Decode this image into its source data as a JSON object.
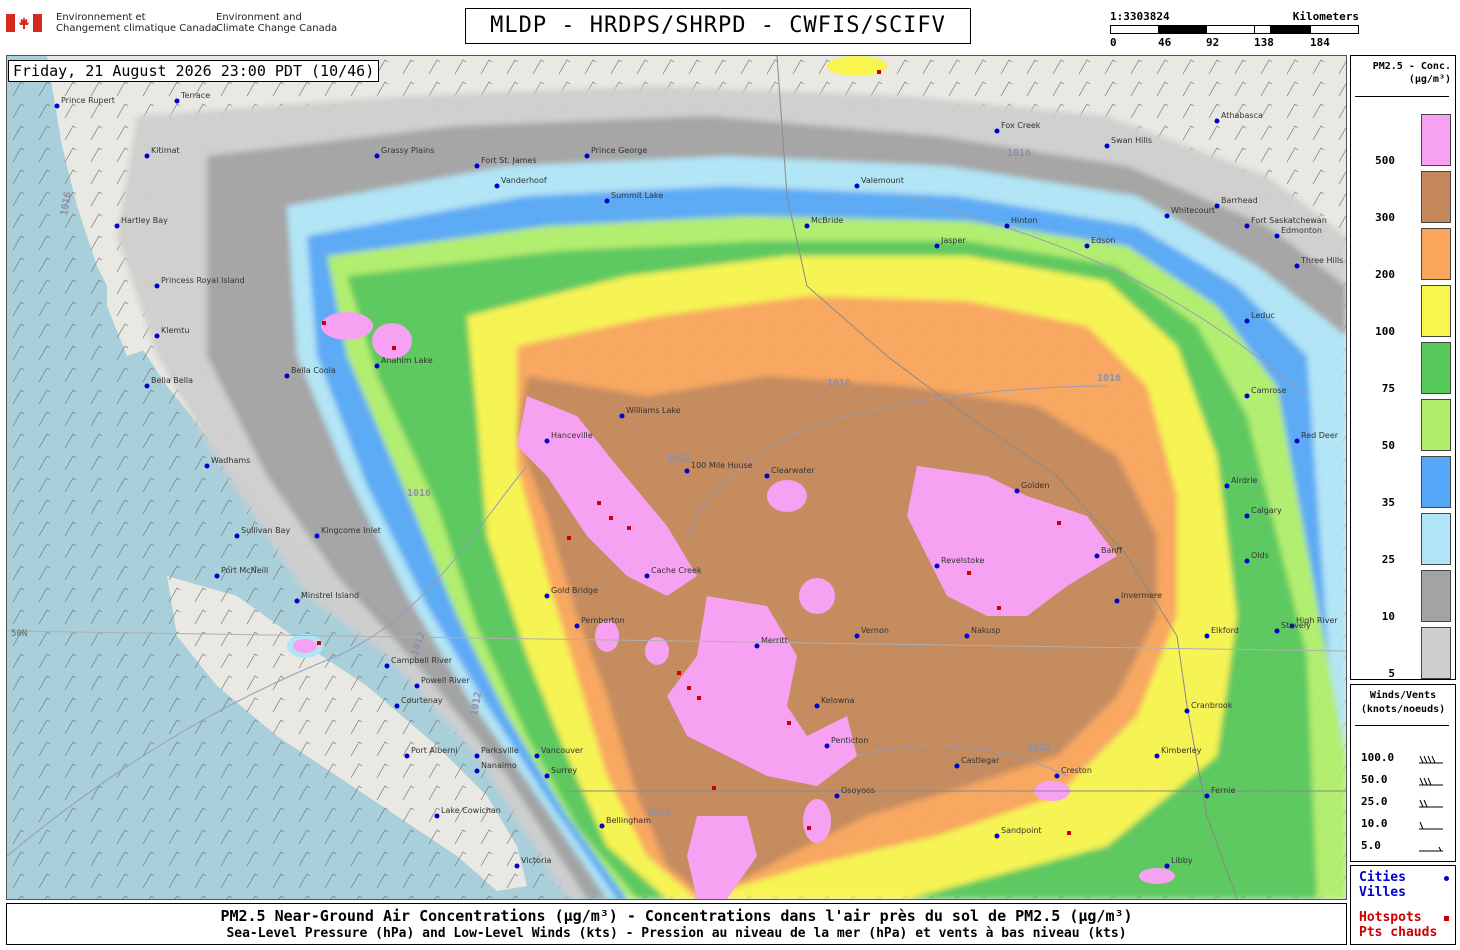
{
  "header": {
    "agency_fr_line1": "Environnement et",
    "agency_fr_line2": "Changement climatique Canada",
    "agency_en_line1": "Environment and",
    "agency_en_line2": "Climate Change Canada",
    "title": "MLDP - HRDPS/SHRPD - CWFIS/SCIFV"
  },
  "scale": {
    "ratio": "1:3303824",
    "unit": "Kilometers",
    "ticks": [
      "0",
      "46",
      "92",
      "138",
      "184"
    ]
  },
  "timestamp": "Friday, 21 August 2026 23:00 PDT (10/46)",
  "legend": {
    "title_line1": "PM2.5 - Conc.",
    "title_line2": "(µg/m³)",
    "levels": [
      {
        "label": "500",
        "color": "#f7a1f2"
      },
      {
        "label": "300",
        "color": "#c4885a"
      },
      {
        "label": "200",
        "color": "#f9a55a"
      },
      {
        "label": "100",
        "color": "#f7f54e"
      },
      {
        "label": "75",
        "color": "#56c85a"
      },
      {
        "label": "50",
        "color": "#b0ef6a"
      },
      {
        "label": "35",
        "color": "#56a7f7"
      },
      {
        "label": "25",
        "color": "#b0e5f7"
      },
      {
        "label": "10",
        "color": "#a3a3a3"
      },
      {
        "label": "5",
        "color": "#cfcfcf"
      }
    ]
  },
  "winds": {
    "title_line1": "Winds/Vents",
    "title_line2": "(knots/noeuds)",
    "values": [
      "100.0",
      "50.0",
      "25.0",
      "10.0",
      "5.0"
    ]
  },
  "markers": {
    "cities_en": "Cities",
    "cities_fr": "Villes",
    "hotspots_en": "Hotspots",
    "hotspots_fr": "Pts chauds",
    "city_color": "#0000cc",
    "hotspot_color": "#cc0000"
  },
  "map": {
    "latitude_label": "50N",
    "isobar_labels": [
      "1012",
      "1016"
    ],
    "cities": [
      "Prince Rupert",
      "Terrace",
      "Kitimat",
      "Hartley Bay",
      "Princess Royal Island",
      "Klemtu",
      "Bella Bella",
      "Bella Coola",
      "Anahim Lake",
      "Wadhams",
      "Sullivan Bay",
      "Kingcome Inlet",
      "Port McNeill",
      "Minstrel Island",
      "Campbell River",
      "Courtenay",
      "Port Alberni",
      "Parksville",
      "Nanaimo",
      "Lake Cowichan",
      "Victoria",
      "Vancouver",
      "Surrey",
      "Bellingham",
      "Powell River",
      "Gold Bridge",
      "Pemberton",
      "Hanceville",
      "Williams Lake",
      "100 Mile House",
      "Clearwater",
      "Cache Creek",
      "Merritt",
      "Kelowna",
      "Penticton",
      "Osoyoos",
      "Vernon",
      "Revelstoke",
      "Nakusp",
      "Golden",
      "Invermere",
      "Cranbrook",
      "Fernie",
      "Castlegar",
      "Creston",
      "Kimberley",
      "Elkford",
      "Calgary",
      "Airdrie",
      "Olds",
      "High River",
      "Stavely",
      "Banff",
      "Prince George",
      "Vanderhoof",
      "Fort St. James",
      "Summit Lake",
      "Grassy Plains",
      "McBride",
      "Valemount",
      "Jasper",
      "Hinton",
      "Edson",
      "Whitecourt",
      "Barrhead",
      "Edmonton",
      "Leduc",
      "Camrose",
      "Red Deer",
      "Three Hills",
      "Swan Hills",
      "Athabasca",
      "Fox Creek",
      "Fort Saskatchewan",
      "Libby",
      "Sandpoint"
    ]
  },
  "footer": {
    "line1": "PM2.5 Near-Ground Air Concentrations (µg/m³) - Concentrations dans l'air près du sol de PM2.5 (µg/m³)",
    "line2": "Sea-Level Pressure (hPa) and Low-Level Winds (kts) - Pression au niveau de la mer (hPa) et vents à bas niveau (kts)"
  }
}
